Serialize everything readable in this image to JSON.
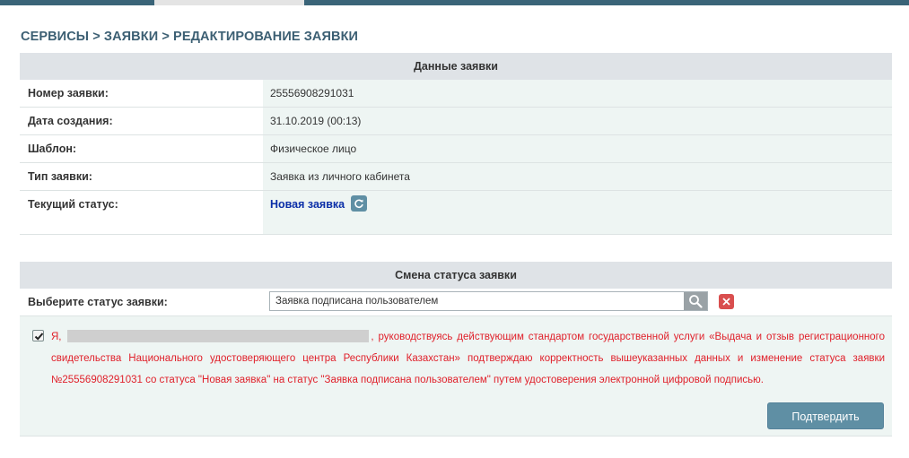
{
  "breadcrumb": "СЕРВИСЫ > ЗАЯВКИ > РЕДАКТИРОВАНИЕ ЗАЯВКИ",
  "request_panel": {
    "title": "Данные заявки",
    "rows": [
      {
        "label": "Номер заявки:",
        "value": "25556908291031"
      },
      {
        "label": "Дата создания:",
        "value": "31.10.2019 (00:13)"
      },
      {
        "label": "Шаблон:",
        "value": "Физическое лицо"
      },
      {
        "label": "Тип заявки:",
        "value": "Заявка из личного кабинета"
      }
    ],
    "status_label": "Текущий статус:",
    "status_value": "Новая заявка"
  },
  "status_panel": {
    "title": "Смена статуса заявки",
    "select_label": "Выберите статус заявки:",
    "select_value": "Заявка подписана пользователем"
  },
  "consent": {
    "checked": true,
    "prefix": "Я,",
    "text": ", руководствуясь действующим стандартом государственной услуги «Выдача и отзыв регистрационного свидетельства Национального удостоверяющего центра Республики Казахстан» подтверждаю корректность вышеуказанных данных и изменение статуса заявки №25556908291031 со статуса \"Новая заявка\" на статус \"Заявка подписана пользователем\" путем удостоверения электронной цифровой подписью."
  },
  "confirm_label": "Подтвердить",
  "icons": {
    "refresh": "refresh-icon",
    "search": "search-icon",
    "clear": "close-icon",
    "check": "check-icon"
  },
  "colors": {
    "accent": "#5f8fa4",
    "consent_text": "#e0202a",
    "status_link": "#0b2fa8",
    "clear_button": "#d94e4e"
  }
}
